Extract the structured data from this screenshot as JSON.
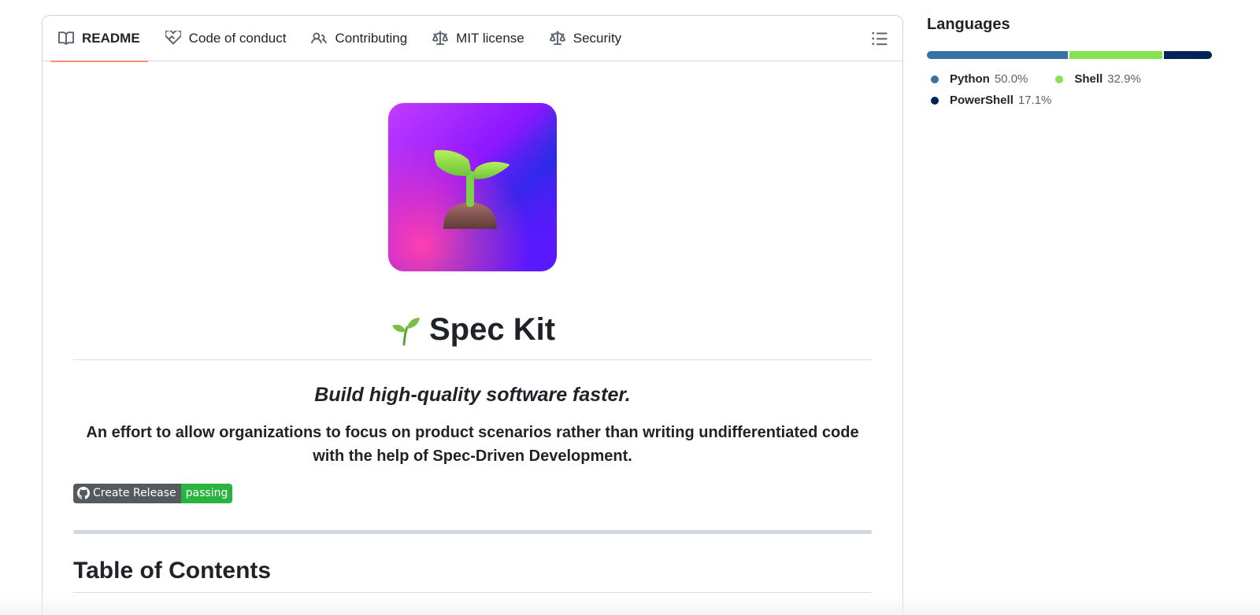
{
  "tabs": [
    {
      "label": "README",
      "icon": "book-icon",
      "active": true
    },
    {
      "label": "Code of conduct",
      "icon": "code-of-conduct-icon",
      "active": false
    },
    {
      "label": "Contributing",
      "icon": "people-icon",
      "active": false
    },
    {
      "label": "MIT license",
      "icon": "law-icon",
      "active": false
    },
    {
      "label": "Security",
      "icon": "law-icon",
      "active": false
    }
  ],
  "outline_icon": "list-unordered-icon",
  "readme": {
    "title": "Spec Kit",
    "title_icon": "seedling-emoji",
    "tagline": "Build high-quality software faster.",
    "description": "An effort to allow organizations to focus on product scenarios rather than writing undifferentiated code with the help of Spec-Driven Development.",
    "badge": {
      "left": "Create Release",
      "right": "passing",
      "left_color": "#555a5e",
      "right_color": "#2ab43f"
    },
    "toc_title": "Table of Contents"
  },
  "languages": {
    "heading": "Languages",
    "items": [
      {
        "name": "Python",
        "percent": "50.0%",
        "value": 50.0,
        "color": "#3572A5"
      },
      {
        "name": "Shell",
        "percent": "32.9%",
        "value": 32.9,
        "color": "#89e051"
      },
      {
        "name": "PowerShell",
        "percent": "17.1%",
        "value": 17.1,
        "color": "#012456"
      }
    ]
  },
  "colors": {
    "active_tab_underline": "#fd8c73",
    "border": "#d0d7de"
  }
}
